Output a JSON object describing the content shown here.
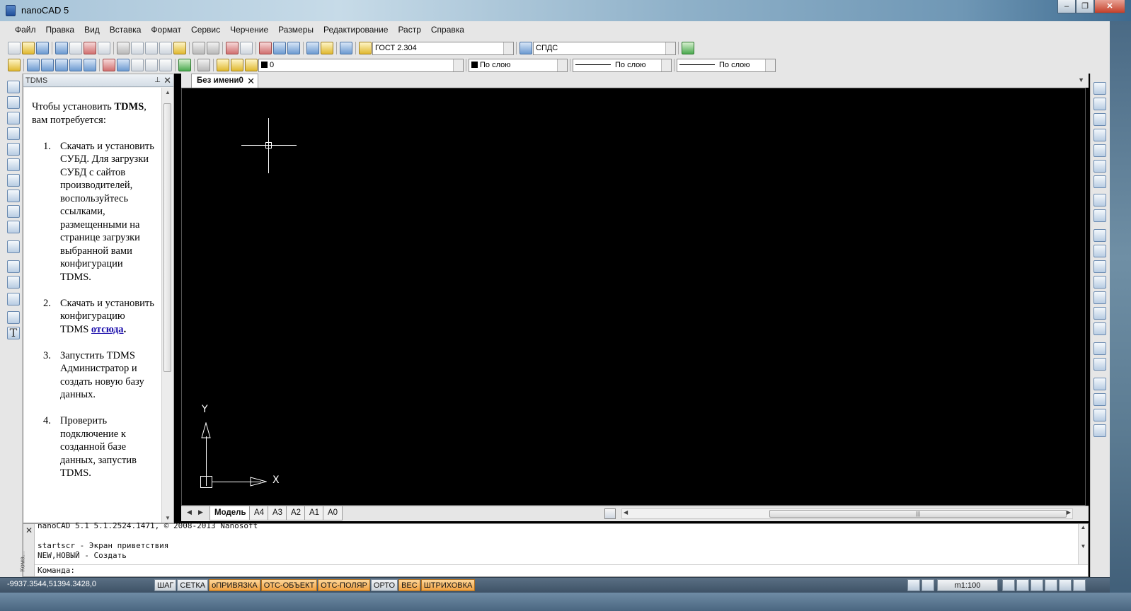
{
  "window": {
    "title": "nanoCAD 5"
  },
  "menu": [
    "Файл",
    "Правка",
    "Вид",
    "Вставка",
    "Формат",
    "Сервис",
    "Черчение",
    "Размеры",
    "Редактирование",
    "Растр",
    "Справка"
  ],
  "toolbar": {
    "text_style": "ГОСТ 2.304",
    "dim_style": "СПДС",
    "layer": "0",
    "color": "По слою",
    "linetype": "По слою",
    "lineweight": "По слою"
  },
  "panel": {
    "title": "TDMS",
    "intro_prefix": "Чтобы установить",
    "intro_bold": "TDMS",
    "intro_suffix": ", вам потребуется:",
    "steps": [
      {
        "num": "1.",
        "text": "Скачать и установить СУБД. Для загрузки СУБД с сайтов производителей, воспользуйтесь ссылками, размещенными на странице загрузки выбранной вами конфигурации TDMS."
      },
      {
        "num": "2.",
        "text": "Скачать и установить конфигурацию TDMS ",
        "link": "отсюда",
        "after": "."
      },
      {
        "num": "3.",
        "text": "Запустить TDMS Администратор и создать новую базу данных."
      },
      {
        "num": "4.",
        "text": "Проверить подключение к созданной базе данных, запустив TDMS."
      }
    ]
  },
  "document": {
    "tab": "Без имени0"
  },
  "ucs": {
    "x": "X",
    "y": "Y"
  },
  "layouts": [
    "Модель",
    "A4",
    "A3",
    "A2",
    "A1",
    "A0"
  ],
  "command": {
    "vertical_label": "Кома...",
    "lines": [
      "nanoCAD 5.1 5.1.2524.1471, © 2008-2013 Nanosoft",
      "",
      "startscr - Экран приветствия",
      "NEW,НОВЫЙ - Создать"
    ],
    "prompt": "Команда:"
  },
  "status": {
    "coords": "-9937.3544,51394.3428,0",
    "buttons": [
      {
        "label": "ШАГ",
        "on": false
      },
      {
        "label": "СЕТКА",
        "on": false
      },
      {
        "label": "оПРИВЯЗКА",
        "on": true
      },
      {
        "label": "ОТС-ОБЪЕКТ",
        "on": true
      },
      {
        "label": "ОТС-ПОЛЯР",
        "on": true
      },
      {
        "label": "ОРТО",
        "on": false
      },
      {
        "label": "ВЕС",
        "on": true
      },
      {
        "label": "ШТРИХОВКА",
        "on": true
      }
    ],
    "scale": "m1:100"
  }
}
